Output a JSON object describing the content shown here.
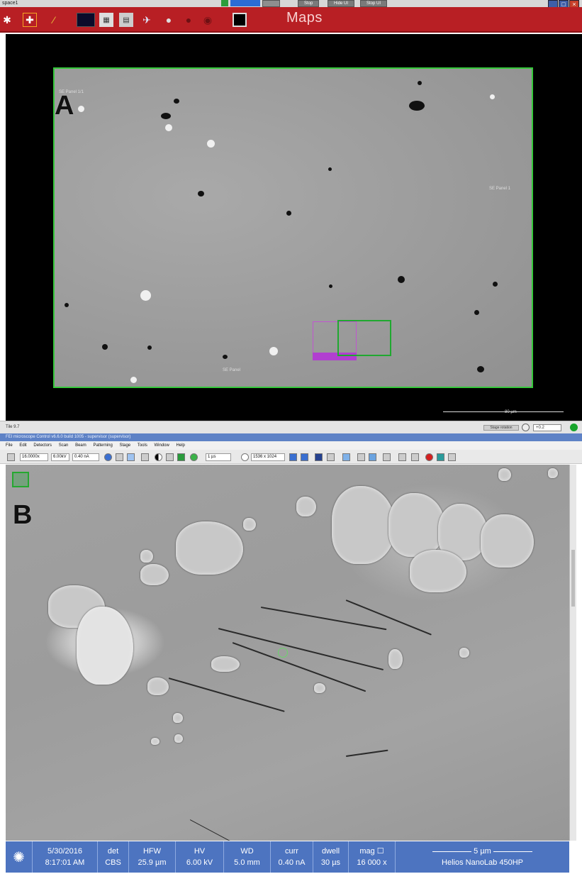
{
  "maps": {
    "window_title": "space1",
    "app_title": "Maps",
    "top_buttons": [
      "Stop",
      "Hide UI",
      "Stop UI"
    ],
    "image_labels": {
      "top_left": "SE Panel 1/1",
      "right": "SE Panel 1",
      "bottom": "SE Panel"
    },
    "scale_bar": "80 µm",
    "status": {
      "left": "Tile 9.7",
      "rotation_label": "Stage rotation",
      "rotation_value": "+0.2"
    },
    "panel_label": "A"
  },
  "microscope": {
    "title": "FEI microscope Control v6.6.0 build 1005 - supervisor (supervisor)",
    "menu": [
      "File",
      "Edit",
      "Detectors",
      "Scan",
      "Beam",
      "Patterning",
      "Stage",
      "Tools",
      "Window",
      "Help"
    ],
    "toolbar": {
      "mag_field": "16.0000x",
      "kv_field": "6.00kV",
      "current_field": "0.40 nA",
      "scan_field": "1 µs",
      "resolution_field": "1536 x 1024"
    },
    "panel_label": "B"
  },
  "databar": {
    "date": "5/30/2016",
    "time": "8:17:01 AM",
    "det_label": "det",
    "det_value": "CBS",
    "hfw_label": "HFW",
    "hfw_value": "25.9 µm",
    "hv_label": "HV",
    "hv_value": "6.00 kV",
    "wd_label": "WD",
    "wd_value": "5.0 mm",
    "curr_label": "curr",
    "curr_value": "0.40 nA",
    "dwell_label": "dwell",
    "dwell_value": "30 µs",
    "mag_label": "mag ☐",
    "mag_value": "16 000 x",
    "scale": "5 µm",
    "instrument": "Helios NanoLab 450HP"
  },
  "colors": {
    "maps_toolbar": "#b81f24",
    "roi_green": "#20a830",
    "roi_magenta": "#c055d0",
    "databar": "#4d74c0"
  }
}
